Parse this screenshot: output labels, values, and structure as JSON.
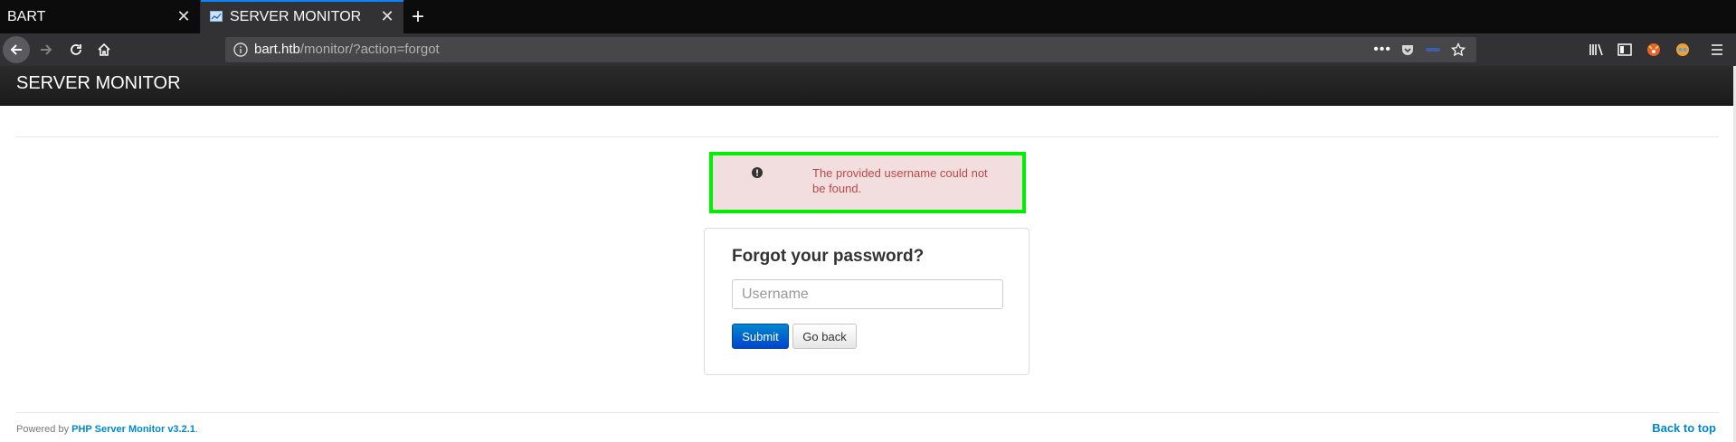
{
  "browser": {
    "tabs": [
      {
        "title": "BART",
        "active": false
      },
      {
        "title": "SERVER MONITOR",
        "active": true
      }
    ],
    "url_host": "bart.htb",
    "url_path": "/monitor/?action=forgot",
    "accent_color": "#0a84ff"
  },
  "header": {
    "brand": "SERVER MONITOR"
  },
  "alert": {
    "message": "The provided username could not be found.",
    "highlight_color": "#00ee00"
  },
  "form": {
    "title": "Forgot your password?",
    "username_placeholder": "Username",
    "username_value": "",
    "submit_label": "Submit",
    "back_label": "Go back"
  },
  "footer": {
    "powered_prefix": "Powered by ",
    "powered_link": "PHP Server Monitor v3.2.1",
    "powered_suffix": ".",
    "back_to_top": "Back to top"
  }
}
